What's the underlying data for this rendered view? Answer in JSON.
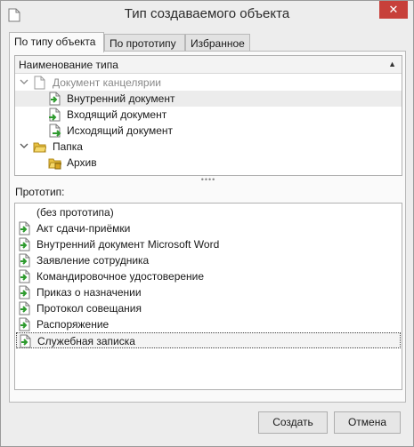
{
  "window": {
    "title": "Тип создаваемого объекта",
    "close_label": "✕"
  },
  "tabs": [
    {
      "label": "По типу объекта",
      "active": true
    },
    {
      "label": "По прототипу",
      "active": false
    },
    {
      "label": "Избранное",
      "active": false
    }
  ],
  "type_tree": {
    "column_header": "Наименование типа",
    "sort_indicator": "▲",
    "rows": [
      {
        "label": "Документ канцелярии",
        "kind": "folder-doc",
        "expanded": true,
        "disabled": true
      },
      {
        "label": "Внутренний документ",
        "kind": "doc-internal",
        "highlighted": true
      },
      {
        "label": "Входящий документ",
        "kind": "doc-incoming"
      },
      {
        "label": "Исходящий документ",
        "kind": "doc-outgoing"
      },
      {
        "label": "Папка",
        "kind": "folder",
        "expanded": true
      },
      {
        "label": "Архив",
        "kind": "archive-folder"
      }
    ]
  },
  "splitter_grip": "••••",
  "prototype": {
    "label": "Прототип:",
    "items": [
      {
        "label": "(без прототипа)",
        "icon": "none"
      },
      {
        "label": "Акт сдачи-приёмки",
        "icon": "doc-icon"
      },
      {
        "label": "Внутренний документ Microsoft Word",
        "icon": "doc-icon"
      },
      {
        "label": "Заявление сотрудника",
        "icon": "doc-icon"
      },
      {
        "label": "Командировочное удостоверение",
        "icon": "doc-icon"
      },
      {
        "label": "Приказ о назначении",
        "icon": "doc-icon"
      },
      {
        "label": "Протокол совещания",
        "icon": "doc-icon"
      },
      {
        "label": "Распоряжение",
        "icon": "doc-icon"
      },
      {
        "label": "Служебная записка",
        "icon": "doc-icon",
        "selected": true
      }
    ]
  },
  "buttons": {
    "create": "Создать",
    "cancel": "Отмена"
  },
  "colors": {
    "close_button": "#c7403a",
    "doc_arrow_green": "#2e9b2e",
    "folder_yellow": "#e8c040",
    "row_highlight": "#ececec"
  }
}
